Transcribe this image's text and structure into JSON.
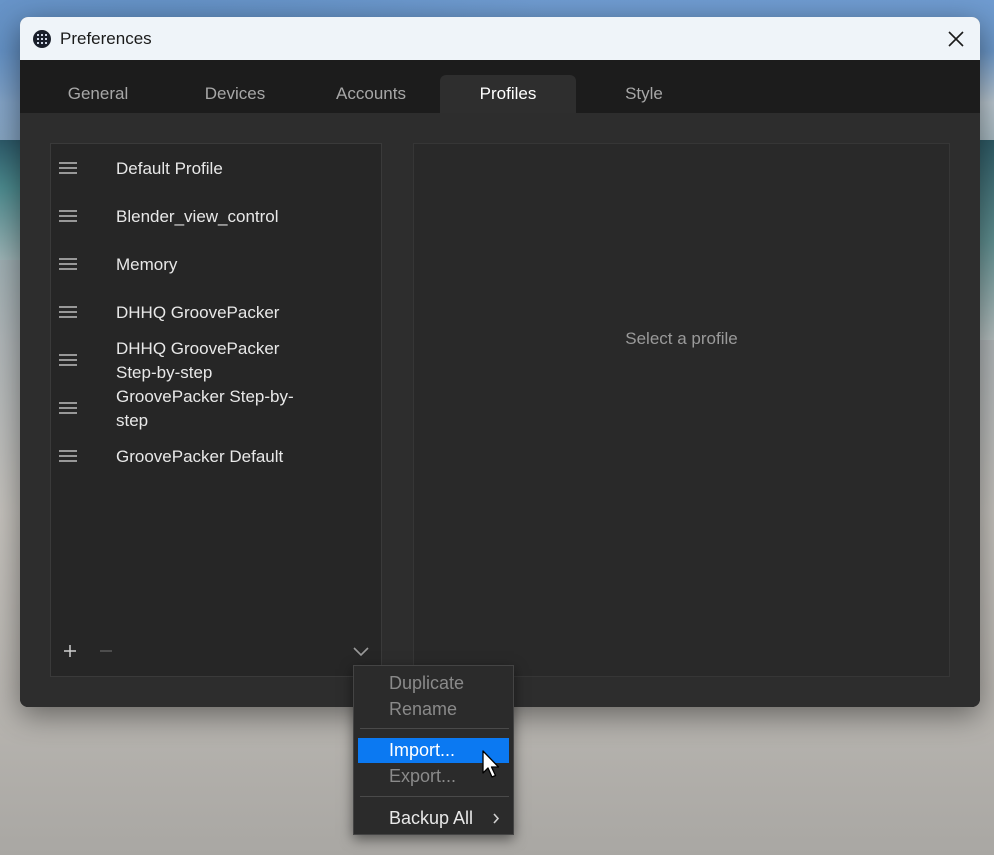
{
  "window": {
    "title": "Preferences",
    "app_icon": "app-grid-icon",
    "close_icon": "close-icon"
  },
  "tabs": [
    {
      "label": "General",
      "active": false
    },
    {
      "label": "Devices",
      "active": false
    },
    {
      "label": "Accounts",
      "active": false
    },
    {
      "label": "Profiles",
      "active": true
    },
    {
      "label": "Style",
      "active": false
    }
  ],
  "profiles": {
    "items": [
      {
        "label": "Default Profile"
      },
      {
        "label": "Blender_view_control"
      },
      {
        "label": "Memory"
      },
      {
        "label": "DHHQ GroovePacker"
      },
      {
        "label": "DHHQ GroovePacker Step-by-step"
      },
      {
        "label": "GroovePacker Step-by-step"
      },
      {
        "label": "GroovePacker Default"
      }
    ],
    "add_icon": "plus-icon",
    "remove_icon": "minus-icon",
    "more_icon": "chevron-down-icon"
  },
  "detail": {
    "placeholder": "Select a profile"
  },
  "context_menu": {
    "items": [
      {
        "label": "Duplicate",
        "enabled": false
      },
      {
        "label": "Rename",
        "enabled": false
      },
      {
        "label": "Import...",
        "enabled": true,
        "highlighted": true
      },
      {
        "label": "Export...",
        "enabled": false
      },
      {
        "label": "Backup All",
        "enabled": true,
        "submenu": true
      }
    ]
  },
  "colors": {
    "accent": "#0b79f2",
    "window_bg": "#2b2b2b",
    "titlebar_bg": "#eff4f9",
    "tabbar_bg": "#1c1c1c"
  }
}
